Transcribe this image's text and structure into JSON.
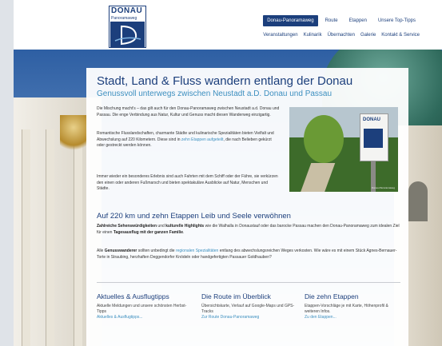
{
  "logo": {
    "title": "DONAU",
    "subtitle": "Panoramaweg"
  },
  "nav": {
    "primary": [
      "Donau-Panoramaweg",
      "Route",
      "Etappen",
      "Unsere Top-Tipps"
    ],
    "secondary": [
      "Veranstaltungen",
      "Kulinarik",
      "Übernachten",
      "Galerie",
      "Kontakt & Service"
    ]
  },
  "main": {
    "title": "Stadt, Land & Fluss wandern entlang der Donau",
    "subtitle": "Genussvoll unterwegs zwischen Neustadt a.D. Donau und Passau",
    "para1": "Die Mischung macht's – das gilt auch für den Donau-Panoramaweg zwischen Neustadt a.d. Donau und Passau. Die enge Verbindung aus Natur, Kultur und Genuss macht diesen Wanderweg einzigartig.",
    "para2_a": "Romantische Flusslandschaften, charmante Städte und kulinarische Spezialitäten bieten Vielfalt und Abwechslung auf 220 Kilometern. Diese sind in ",
    "para2_link": "zehn Etappen aufgeteilt",
    "para2_b": ", die nach Belieben gekürzt oder gestreckt werden können.",
    "para3": "Immer wieder ein besonderes Erlebnis sind auch Fahrten mit dem Schiff oder der Fähre, sie verkürzen den einen oder anderen Fußmarsch und bieten spektakuläre Ausblicke auf Natur, Menschen und Städte.",
    "photo_sign": "DONAU",
    "photo_caption": "Donau-Panoramaweg",
    "h2": "Auf 220 km und zehn Etappen Leib und Seele verwöhnen",
    "p4_b1": "Zahlreiche Sehenswürdigkeiten",
    "p4_t1": " und ",
    "p4_b2": "kulturelle Highlights",
    "p4_t2": " wie die Walhalla in Donaustauf oder das barocke Passau machen den Donau-Panoramaweg zum idealen Ziel für einen ",
    "p4_b3": "Tagesausflug mit der ganzen Familie",
    "p4_t3": ".",
    "p5_t1": "Alle ",
    "p5_b1": "Genusswanderer",
    "p5_t2": " sollten unbedingt die ",
    "p5_link": "regionalen Spezialitäten",
    "p5_t3": " entlang des abwechslungsreichen Weges verkosten. Wie wäre es mit einem Stück Agnes-Bernauer-Torte in Straubing, herzhaften Deggendorfer Knödeln oder handgefertigten Passauer Goldhauben?"
  },
  "columns": [
    {
      "title": "Aktuelles & Ausflugtipps",
      "desc": "Aktuelle Meldungen und unsere schönsten Herbst-Tipps",
      "link": "Aktuelles & Ausflugtipps..."
    },
    {
      "title": "Die Route im Überblick",
      "desc": "Übersichtskarte, Verlauf auf Google-Maps und GPS-Tracks",
      "link": "Zur Route Donau-Panoramaweg"
    },
    {
      "title": "Die zehn Etappen",
      "desc": "Etappen-Vorschläge je mit Karte, Höhenprofil & weiteren Infos.",
      "link": "Zu den Etappen..."
    }
  ]
}
